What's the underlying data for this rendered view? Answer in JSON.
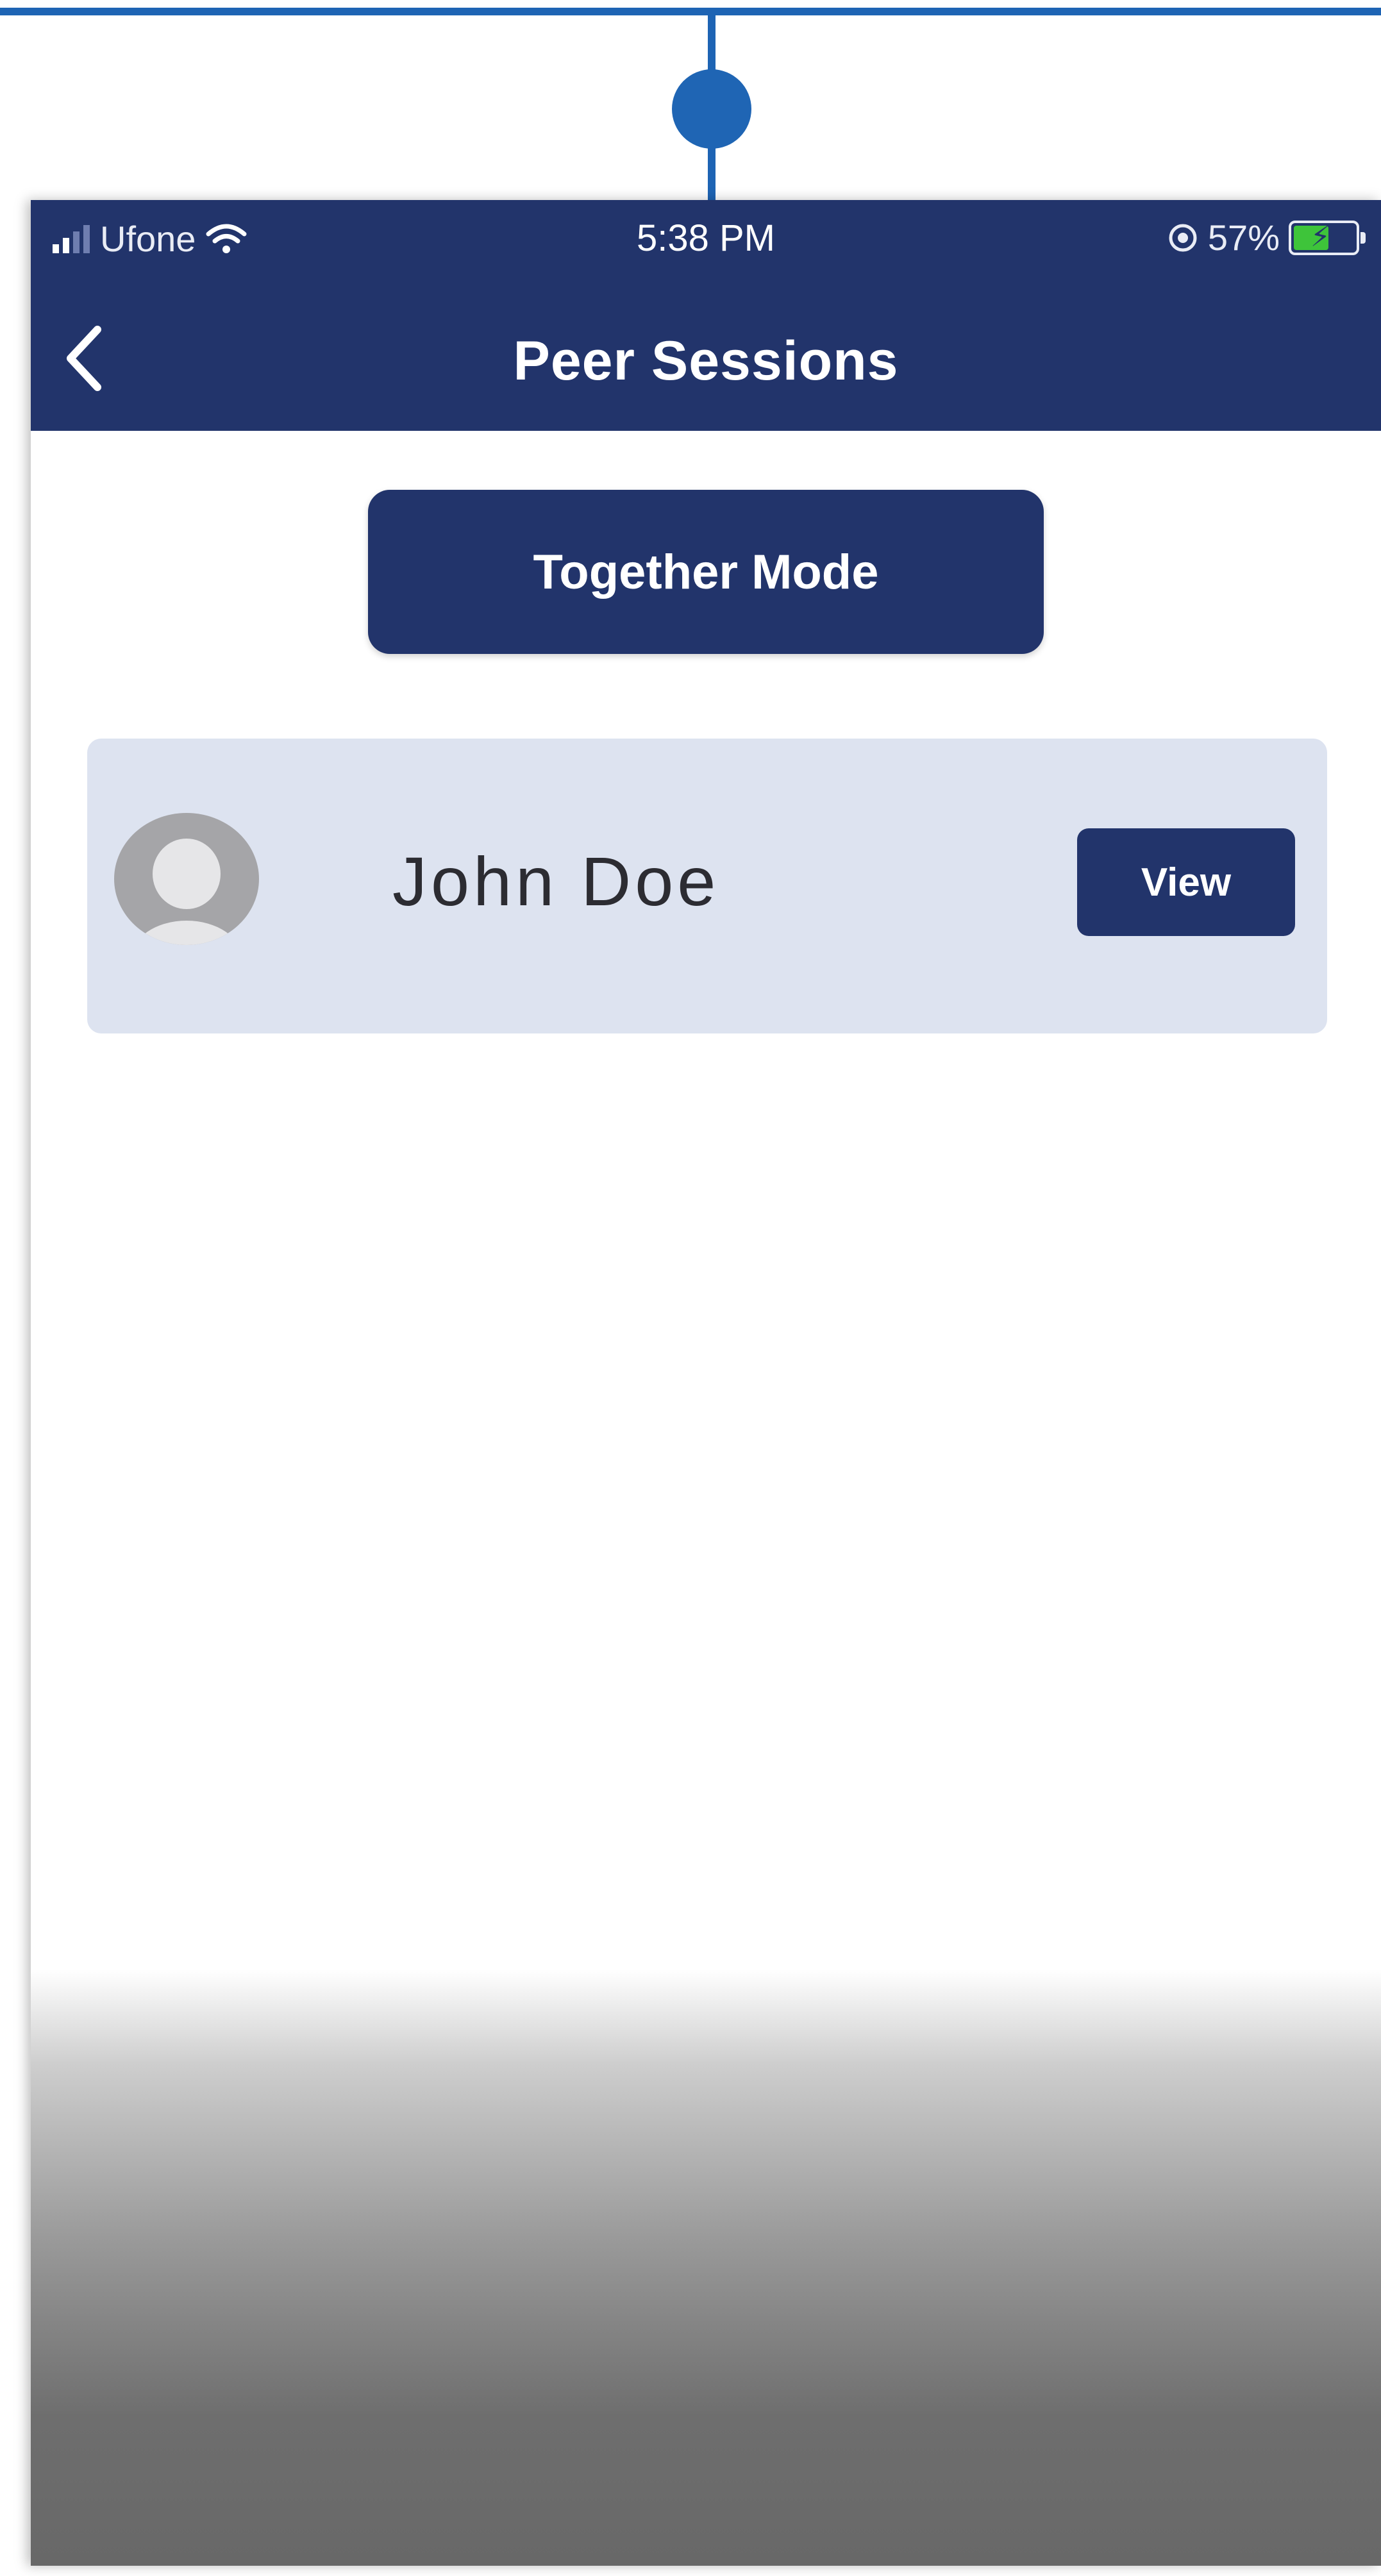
{
  "status_bar": {
    "carrier": "Ufone",
    "time": "5:38 PM",
    "battery_percent": "57%",
    "battery_level": 0.57,
    "charging": true
  },
  "header": {
    "title": "Peer Sessions",
    "back_icon": "chevron-left-icon"
  },
  "main": {
    "together_mode_label": "Together Mode",
    "peers": [
      {
        "name": "John Doe",
        "action_label": "View",
        "avatar_icon": "user-avatar-icon"
      }
    ]
  },
  "colors": {
    "primary": "#22346b",
    "card_background": "#dde3f0",
    "callout": "#1e64b4",
    "battery_green": "#3ec43a"
  }
}
